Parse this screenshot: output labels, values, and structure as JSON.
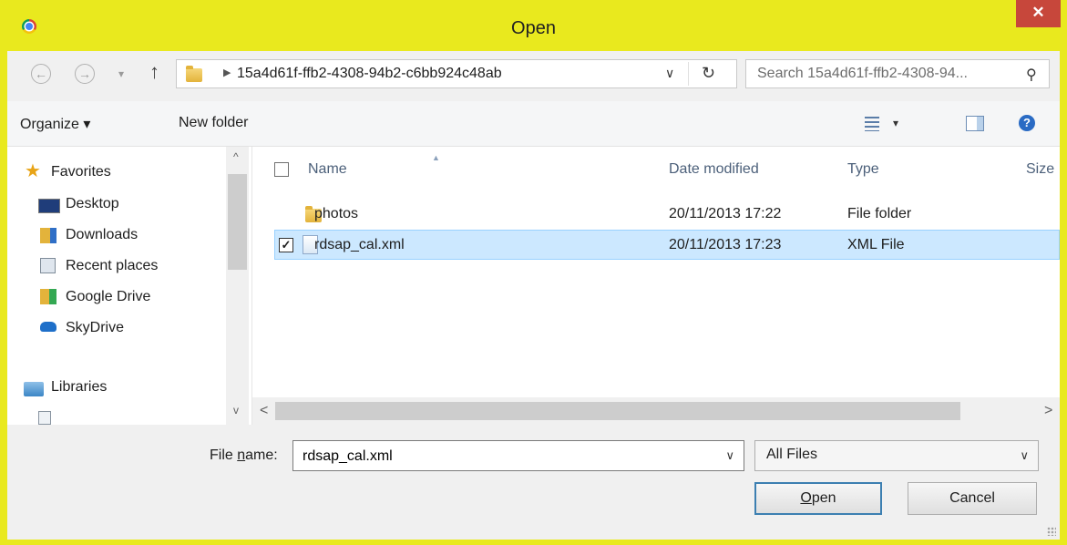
{
  "window": {
    "title": "Open",
    "close_glyph": "✕",
    "app_icon": "chrome-icon"
  },
  "navigation": {
    "back_glyph": "←",
    "forward_glyph": "→",
    "recent_glyph": "▾",
    "up_glyph": "↑",
    "path": "15a4d61f-ffb2-4308-94b2-c6bb924c48ab",
    "search_placeholder": "Search 15a4d61f-ffb2-4308-94...",
    "refresh_glyph": "↻",
    "dropdown_glyph": "∨"
  },
  "toolbar": {
    "organize": "Organize ▾",
    "new_folder": "New folder",
    "views_dropdown": "▾",
    "help_glyph": "?"
  },
  "nav_pane": {
    "favorites": "Favorites",
    "items": [
      {
        "label": "Desktop",
        "icon": "desktop-icon"
      },
      {
        "label": "Downloads",
        "icon": "downloads-icon"
      },
      {
        "label": "Recent places",
        "icon": "recent-places-icon"
      },
      {
        "label": "Google Drive",
        "icon": "google-drive-icon"
      },
      {
        "label": "SkyDrive",
        "icon": "skydrive-icon"
      }
    ],
    "libraries": "Libraries",
    "scroll_up": "^",
    "scroll_down": "v"
  },
  "file_list": {
    "columns": [
      "Name",
      "Date modified",
      "Type",
      "Size"
    ],
    "rows": [
      {
        "name": "photos",
        "date": "20/11/2013 17:22",
        "type": "File folder",
        "selected": false,
        "icon": "folder-icon"
      },
      {
        "name": "rdsap_cal.xml",
        "date": "20/11/2013 17:23",
        "type": "XML File",
        "selected": true,
        "icon": "xml-file-icon"
      }
    ],
    "scroll_left": "<",
    "scroll_right": ">"
  },
  "bottom": {
    "file_name_label_prefix": "File ",
    "file_name_label_accel": "n",
    "file_name_label_suffix": "ame:",
    "file_name_value": "rdsap_cal.xml",
    "file_type": "All Files",
    "open_accel": "O",
    "open_rest": "pen",
    "cancel": "Cancel",
    "dropdown_glyph": "∨"
  },
  "colors": {
    "frame": "#e9e91e",
    "close": "#c7473b",
    "selection": "#cce8ff"
  }
}
